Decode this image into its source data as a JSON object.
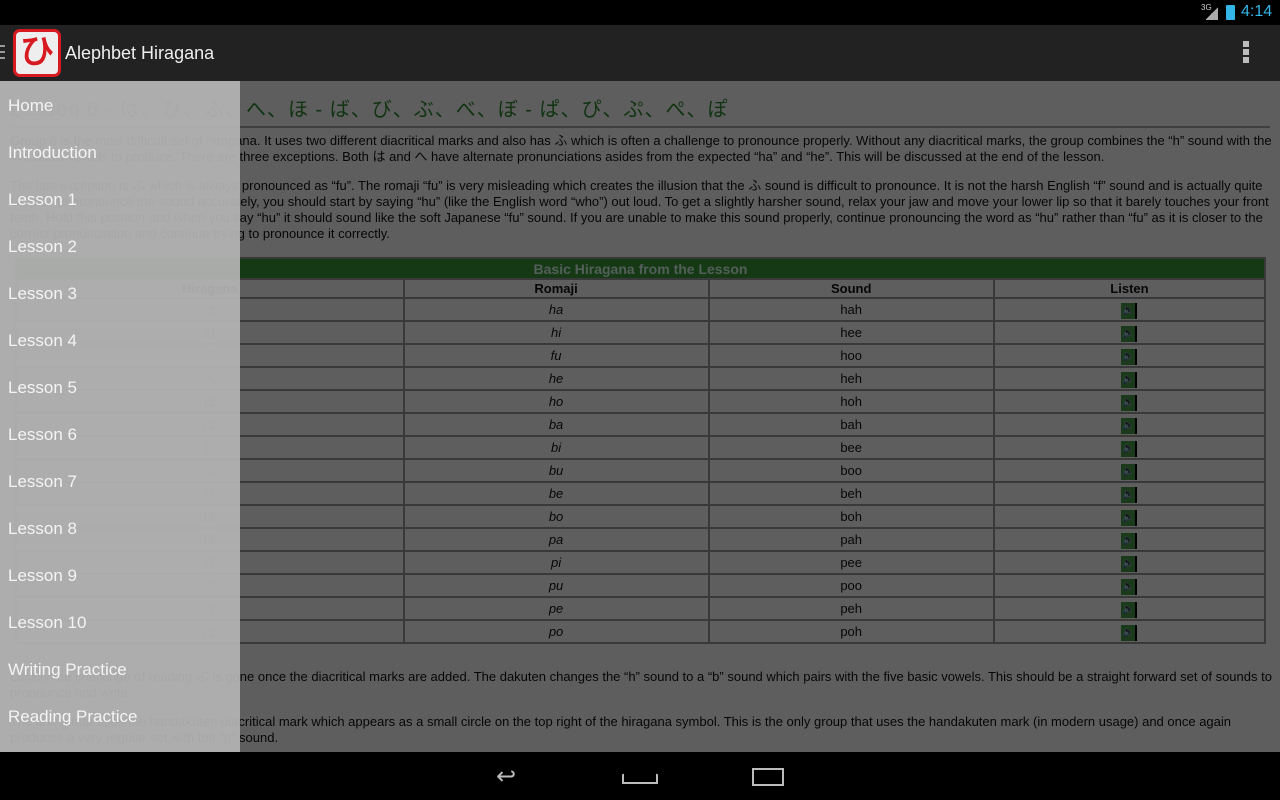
{
  "status": {
    "network": "3G",
    "time": "4:14"
  },
  "appbar": {
    "logo": "ひ",
    "title": "Alephbet Hiragana"
  },
  "page": {
    "heading": "Lesson 6 - は、ひ、ふ、へ、ほ - ば、び、ぶ、べ、ぼ - ぱ、ぴ、ぷ、ぺ、ぽ",
    "p1": "Group 6 is the most difficult set of hiragana. It uses two different diacritical marks and also has ふ which is often a challenge to pronounce properly. Without any diacritical marks, the group combines the “h” sound with the five basic vowels to produce. There are three exceptions. Both は and へ have alternate pronunciations asides from the expected “ha” and “he”. This will be discussed at the end of the lesson.",
    "p2": "The last exception is ふ which is always pronounced as “fu”. The romaji “fu” is very misleading which creates the illusion that the ふ sound is difficult to pronounce. It is not the harsh English “f” sound and is actually quite simple. To pronounce the sound accurately, you should start by saying “hu” (like the English word “who”) out loud. To get a slightly harsher sound, relax your jaw and move your lower lip so that it barely touches your front teeth. Hold this position and when you say “hu” it should sound like the soft Japanese “fu” sound. If you are unable to make this sound properly, continue pronouncing the word as “hu” rather than “fu” as it is closer to the correct pronunciation and continue trying to pronounce it correctly.",
    "p3": "Luckily the challenge of reading ぶ is gone once the diacritical marks are added. The dakuten changes the “h” sound to a “b” sound which pairs with the five basic vowels. This should be a straight forward set of sounds to pronounce and write.",
    "p4": "The last group uses the handakuten diacritical mark which appears as a small circle on the top right of the hiragana symbol. This is the only group that uses the handakuten mark (in modern usage) and once again produces a very regular set with the “p” sound.",
    "table": {
      "caption": "Basic Hiragana from the Lesson",
      "headers": [
        "Hiragana",
        "Romaji",
        "Sound",
        "Listen"
      ],
      "rows": [
        [
          "は",
          "ha",
          "hah"
        ],
        [
          "ひ",
          "hi",
          "hee"
        ],
        [
          "ふ",
          "fu",
          "hoo"
        ],
        [
          "へ",
          "he",
          "heh"
        ],
        [
          "ほ",
          "ho",
          "hoh"
        ],
        [
          "ば",
          "ba",
          "bah"
        ],
        [
          "び",
          "bi",
          "bee"
        ],
        [
          "ぶ",
          "bu",
          "boo"
        ],
        [
          "べ",
          "be",
          "beh"
        ],
        [
          "ぼ",
          "bo",
          "boh"
        ],
        [
          "ぱ",
          "pa",
          "pah"
        ],
        [
          "ぴ",
          "pi",
          "pee"
        ],
        [
          "ぷ",
          "pu",
          "poo"
        ],
        [
          "ぺ",
          "pe",
          "peh"
        ],
        [
          "ぽ",
          "po",
          "poh"
        ]
      ]
    }
  },
  "drawer": {
    "items": [
      "Home",
      "Introduction",
      "Lesson 1",
      "Lesson 2",
      "Lesson 3",
      "Lesson 4",
      "Lesson 5",
      "Lesson 6",
      "Lesson 7",
      "Lesson 8",
      "Lesson 9",
      "Lesson 10",
      "Writing Practice",
      "Reading Practice"
    ]
  },
  "colors": {
    "accent": "#3a9a3a",
    "logo": "#d71920",
    "status": "#33b5e5"
  }
}
